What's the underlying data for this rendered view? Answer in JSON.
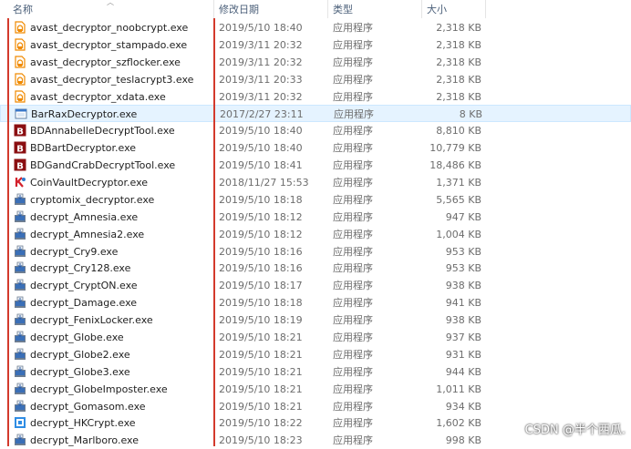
{
  "header": {
    "col_name": "名称",
    "col_date": "修改日期",
    "col_type": "类型",
    "col_size": "大小"
  },
  "files": [
    {
      "name": "avast_decryptor_noobcrypt.exe",
      "date": "2019/5/10 18:40",
      "type": "应用程序",
      "size": "2,318 KB",
      "icon": "avast-shield-icon"
    },
    {
      "name": "avast_decryptor_stampado.exe",
      "date": "2019/3/11 20:32",
      "type": "应用程序",
      "size": "2,318 KB",
      "icon": "avast-shield-icon"
    },
    {
      "name": "avast_decryptor_szflocker.exe",
      "date": "2019/3/11 20:32",
      "type": "应用程序",
      "size": "2,318 KB",
      "icon": "avast-shield-icon"
    },
    {
      "name": "avast_decryptor_teslacrypt3.exe",
      "date": "2019/3/11 20:33",
      "type": "应用程序",
      "size": "2,318 KB",
      "icon": "avast-shield-icon"
    },
    {
      "name": "avast_decryptor_xdata.exe",
      "date": "2019/3/11 20:32",
      "type": "应用程序",
      "size": "2,318 KB",
      "icon": "avast-shield-icon"
    },
    {
      "name": "BarRaxDecryptor.exe",
      "date": "2017/2/27 23:11",
      "type": "应用程序",
      "size": "8 KB",
      "icon": "window-app-icon",
      "selected": true
    },
    {
      "name": "BDAnnabelleDecryptTool.exe",
      "date": "2019/5/10 18:40",
      "type": "应用程序",
      "size": "8,810 KB",
      "icon": "bitdefender-b-icon"
    },
    {
      "name": "BDBartDecryptor.exe",
      "date": "2019/5/10 18:40",
      "type": "应用程序",
      "size": "10,779 KB",
      "icon": "bitdefender-b-icon"
    },
    {
      "name": "BDGandCrabDecryptTool.exe",
      "date": "2019/5/10 18:41",
      "type": "应用程序",
      "size": "18,486 KB",
      "icon": "bitdefender-b-icon"
    },
    {
      "name": "CoinVaultDecryptor.exe",
      "date": "2018/11/27 15:53",
      "type": "应用程序",
      "size": "1,371 KB",
      "icon": "kaspersky-k-icon"
    },
    {
      "name": "cryptomix_decryptor.exe",
      "date": "2019/5/10 18:18",
      "type": "应用程序",
      "size": "5,565 KB",
      "icon": "installer-icon"
    },
    {
      "name": "decrypt_Amnesia.exe",
      "date": "2019/5/10 18:12",
      "type": "应用程序",
      "size": "947 KB",
      "icon": "installer-icon"
    },
    {
      "name": "decrypt_Amnesia2.exe",
      "date": "2019/5/10 18:12",
      "type": "应用程序",
      "size": "1,004 KB",
      "icon": "installer-icon"
    },
    {
      "name": "decrypt_Cry9.exe",
      "date": "2019/5/10 18:16",
      "type": "应用程序",
      "size": "953 KB",
      "icon": "installer-icon"
    },
    {
      "name": "decrypt_Cry128.exe",
      "date": "2019/5/10 18:16",
      "type": "应用程序",
      "size": "953 KB",
      "icon": "installer-icon"
    },
    {
      "name": "decrypt_CryptON.exe",
      "date": "2019/5/10 18:17",
      "type": "应用程序",
      "size": "938 KB",
      "icon": "installer-icon"
    },
    {
      "name": "decrypt_Damage.exe",
      "date": "2019/5/10 18:18",
      "type": "应用程序",
      "size": "941 KB",
      "icon": "installer-icon"
    },
    {
      "name": "decrypt_FenixLocker.exe",
      "date": "2019/5/10 18:19",
      "type": "应用程序",
      "size": "938 KB",
      "icon": "installer-icon"
    },
    {
      "name": "decrypt_Globe.exe",
      "date": "2019/5/10 18:21",
      "type": "应用程序",
      "size": "937 KB",
      "icon": "installer-icon"
    },
    {
      "name": "decrypt_Globe2.exe",
      "date": "2019/5/10 18:21",
      "type": "应用程序",
      "size": "931 KB",
      "icon": "installer-icon"
    },
    {
      "name": "decrypt_Globe3.exe",
      "date": "2019/5/10 18:21",
      "type": "应用程序",
      "size": "944 KB",
      "icon": "installer-icon"
    },
    {
      "name": "decrypt_GlobeImposter.exe",
      "date": "2019/5/10 18:21",
      "type": "应用程序",
      "size": "1,011 KB",
      "icon": "installer-icon"
    },
    {
      "name": "decrypt_Gomasom.exe",
      "date": "2019/5/10 18:21",
      "type": "应用程序",
      "size": "934 KB",
      "icon": "installer-icon"
    },
    {
      "name": "decrypt_HKCrypt.exe",
      "date": "2019/5/10 18:22",
      "type": "应用程序",
      "size": "1,602 KB",
      "icon": "installer-blue-icon"
    },
    {
      "name": "decrypt_Marlboro.exe",
      "date": "2019/5/10 18:23",
      "type": "应用程序",
      "size": "998 KB",
      "icon": "installer-icon"
    }
  ],
  "watermark": "CSDN @半个西瓜.",
  "colors": {
    "header_text": "#4c607a",
    "selected_row": "#e5f3ff",
    "annotation_red": "#d33a2c"
  }
}
